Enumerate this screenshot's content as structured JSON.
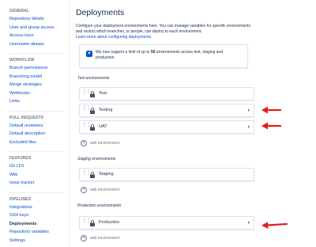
{
  "sidebar": {
    "sections": [
      {
        "heading": "GENERAL",
        "items": [
          "Repository details",
          "User and group access",
          "Access keys",
          "Username aliases"
        ]
      },
      {
        "heading": "WORKFLOW",
        "items": [
          "Branch permissions",
          "Branching model",
          "Merge strategies",
          "Webhooks",
          "Links"
        ]
      },
      {
        "heading": "PULL REQUESTS",
        "items": [
          "Default reviewers",
          "Default description",
          "Excluded files"
        ]
      },
      {
        "heading": "FEATURES",
        "items": [
          "Git LFS",
          "Wiki",
          "Issue tracker"
        ]
      },
      {
        "heading": "PIPELINES",
        "items": [
          "Integrations",
          "SSH keys",
          "Deployments",
          "Repository variables",
          "Settings"
        ]
      }
    ],
    "active_item": "Deployments"
  },
  "main": {
    "title": "Deployments",
    "intro": "Configure your deployment environments here. You can manage variables for specific environments and restrict which branches, or people, can deploy to each environment.",
    "learn_more": "Learn more about configuring deployments.",
    "info": {
      "prefix": "We now support a limit of up to ",
      "limit": "50",
      "suffix": " environments across test, staging and production."
    },
    "groups": {
      "test": {
        "label": "Test environments",
        "envs": [
          "Test",
          "Testing",
          "UAT"
        ]
      },
      "staging": {
        "label": "Staging environments",
        "envs": [
          "Staging"
        ]
      },
      "production": {
        "label": "Production environments",
        "envs": [
          "Production"
        ]
      }
    },
    "add_env_label": "add environment",
    "chevron": "›"
  },
  "colors": {
    "link": "#0052cc",
    "text": "#172b4d",
    "muted": "#6b778c",
    "arrow": "#e01e1e"
  }
}
